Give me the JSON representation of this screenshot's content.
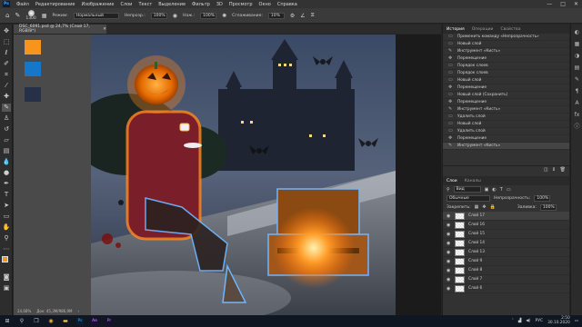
{
  "menubar": {
    "items": [
      "Файл",
      "Редактирование",
      "Изображение",
      "Слои",
      "Текст",
      "Выделение",
      "Фильтр",
      "3D",
      "Просмотр",
      "Окно",
      "Справка"
    ],
    "ps_logo": "Ps",
    "window_controls": [
      "—",
      "□",
      "✕"
    ]
  },
  "options": {
    "brush_size": "1300",
    "mode_label": "Режим:",
    "mode_value": "Нормальный",
    "opacity_label": "Непрозр.:",
    "opacity_value": "100%",
    "flow_label": "Наж.:",
    "flow_value": "100%",
    "smoothing_label": "Сглаживание:",
    "smoothing_value": "10%"
  },
  "document": {
    "tab_title": "DSC_6091.psd @ 24,7% (Слой 17, RGB/8*)",
    "status_zoom": "24,68%",
    "status_doc": "Док: 45,3M/986,9M"
  },
  "swatches": {
    "colors": [
      "#f7941d",
      "#1677c9",
      "#263148",
      "#ffffff"
    ]
  },
  "history": {
    "tabs": [
      "История",
      "Операции",
      "Свойства"
    ],
    "items": [
      "Применить команду «Непрозрачность»",
      "Новый слой",
      "Инструмент «Кисть»",
      "Перемещение",
      "Порядок слоев",
      "Порядок слоев",
      "Новый слой",
      "Перемещение",
      "Новый слой (Сохранить)",
      "Перемещение",
      "Инструмент «Кисть»",
      "Удалить слой",
      "Новый слой",
      "Удалить слой",
      "Перемещение",
      "Инструмент «Кисть»"
    ]
  },
  "layers": {
    "tabs": [
      "Слои",
      "Каналы"
    ],
    "filter_label": "Вид",
    "blend_value": "Обычные",
    "opacity_label": "Непрозрачность:",
    "opacity_value": "100%",
    "lock_label": "Закрепить:",
    "fill_label": "Заливка:",
    "fill_value": "100%",
    "items": [
      "Слой 17",
      "Слой 16",
      "Слой 15",
      "Слой 14",
      "Слой 13",
      "Слой 9",
      "Слой 8",
      "Слой 7",
      "Слой 6"
    ]
  },
  "taskbar": {
    "lang": "РУС",
    "time": "2:50",
    "date": "30.10.2020"
  },
  "colors": {
    "accent": "#f7941d",
    "panel_bg": "#323232",
    "canvas_bg": "#1b1b1b"
  }
}
